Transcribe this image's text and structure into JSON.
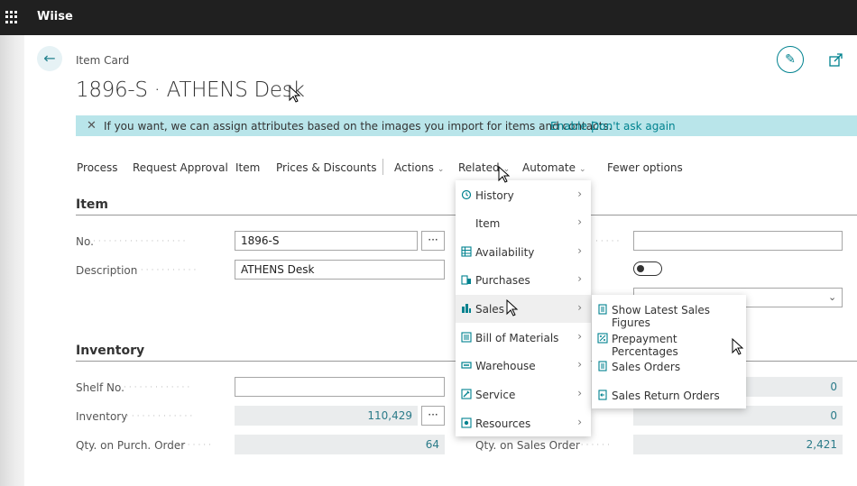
{
  "app": {
    "name": "Wiise"
  },
  "page": {
    "breadcrumb": "Item Card",
    "title": "1896-S · ATHENS Desk"
  },
  "banner": {
    "text": "If you want, we can assign attributes based on the images you import for items and contacts.",
    "enable": "Enable |",
    "dont_ask": "Don't ask again"
  },
  "actionbar": {
    "process": "Process",
    "request_approval": "Request Approval",
    "item": "Item",
    "prices_discounts": "Prices & Discounts",
    "actions": "Actions",
    "related": "Related",
    "automate": "Automate",
    "fewer": "Fewer options"
  },
  "item_section": {
    "title": "Item",
    "no_label": "No.",
    "no_value": "1896-S",
    "desc_label": "Description",
    "desc_value": "ATHENS Desk",
    "ellipsis": "···"
  },
  "inventory_section": {
    "title": "Inventory",
    "shelf_label": "Shelf No.",
    "inventory_label": "Inventory",
    "inventory_value": "110,429",
    "purch_label": "Qty. on Purch. Order",
    "purch_value": "64",
    "right_val1": "0",
    "right_val2": "0",
    "sales_order_label": "Qty. on Sales Order",
    "sales_order_value": "2,421"
  },
  "related_menu": {
    "items": [
      {
        "label": "History",
        "icon": "history-icon"
      },
      {
        "label": "Item",
        "icon": ""
      },
      {
        "label": "Availability",
        "icon": "availability-icon"
      },
      {
        "label": "Purchases",
        "icon": "purchases-icon"
      },
      {
        "label": "Sales",
        "icon": "sales-icon"
      },
      {
        "label": "Bill of Materials",
        "icon": "bom-icon"
      },
      {
        "label": "Warehouse",
        "icon": "warehouse-icon"
      },
      {
        "label": "Service",
        "icon": "service-icon"
      },
      {
        "label": "Resources",
        "icon": "resources-icon"
      }
    ]
  },
  "sales_submenu": {
    "items": [
      {
        "label": "Show Latest Sales Figures"
      },
      {
        "label": "Prepayment Percentages"
      },
      {
        "label": "Sales Orders"
      },
      {
        "label": "Sales Return Orders"
      }
    ]
  },
  "colors": {
    "accent": "#00828f",
    "banner": "#b9e5ea",
    "topbar": "#202020"
  }
}
